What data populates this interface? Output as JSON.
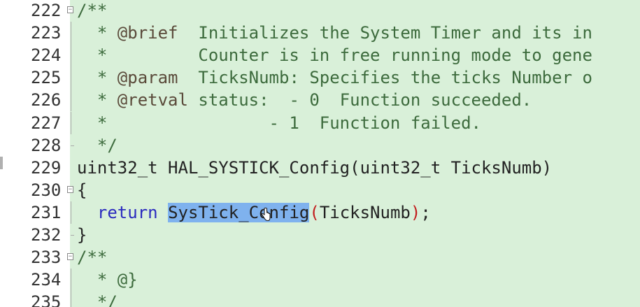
{
  "editor": {
    "lines": [
      {
        "num": "222",
        "parts": [
          {
            "t": "/**",
            "c": "comment"
          }
        ]
      },
      {
        "num": "223",
        "parts": [
          {
            "t": "  * ",
            "c": "comment"
          },
          {
            "t": "@brief",
            "c": "comment-tag"
          },
          {
            "t": "  Initializes the System Timer and its in",
            "c": "comment"
          }
        ]
      },
      {
        "num": "224",
        "parts": [
          {
            "t": "  *         Counter is in free running mode to gene",
            "c": "comment"
          }
        ]
      },
      {
        "num": "225",
        "parts": [
          {
            "t": "  * ",
            "c": "comment"
          },
          {
            "t": "@param",
            "c": "comment-tag"
          },
          {
            "t": "  TicksNumb: Specifies the ticks Number o",
            "c": "comment"
          }
        ]
      },
      {
        "num": "226",
        "parts": [
          {
            "t": "  * ",
            "c": "comment"
          },
          {
            "t": "@retval",
            "c": "comment-tag"
          },
          {
            "t": " status:  - 0  Function succeeded.",
            "c": "comment"
          }
        ]
      },
      {
        "num": "227",
        "parts": [
          {
            "t": "  *                - 1  Function failed.",
            "c": "comment"
          }
        ]
      },
      {
        "num": "228",
        "parts": [
          {
            "t": "  */",
            "c": "comment"
          }
        ]
      },
      {
        "num": "229",
        "parts": [
          {
            "t": "uint32_t HAL_SYSTICK_Config(uint32_t TicksNumb)",
            "c": ""
          }
        ]
      },
      {
        "num": "230",
        "parts": [
          {
            "t": "{",
            "c": ""
          }
        ]
      },
      {
        "num": "231",
        "parts": [
          {
            "t": "  ",
            "c": ""
          },
          {
            "t": "return",
            "c": "kw"
          },
          {
            "t": " ",
            "c": ""
          },
          {
            "t": "SysTick_Config",
            "c": "sel"
          },
          {
            "t": "(",
            "c": "paren-red"
          },
          {
            "t": "TicksNumb",
            "c": ""
          },
          {
            "t": ")",
            "c": "paren-red"
          },
          {
            "t": ";",
            "c": ""
          }
        ]
      },
      {
        "num": "232",
        "parts": [
          {
            "t": "}",
            "c": ""
          }
        ]
      },
      {
        "num": "233",
        "parts": [
          {
            "t": "/**",
            "c": "comment"
          }
        ]
      },
      {
        "num": "234",
        "parts": [
          {
            "t": "  * @}",
            "c": "comment"
          }
        ]
      },
      {
        "num": "235",
        "parts": [
          {
            "t": "  */",
            "c": "comment"
          }
        ]
      }
    ],
    "fold_markers": [
      "box",
      "vline",
      "vline",
      "vline",
      "vline",
      "vline",
      "tick",
      "none",
      "box",
      "vline",
      "tick",
      "box",
      "vline",
      "vline"
    ],
    "selected_text": "SysTick_Config",
    "cursor": "hand-pointer-icon"
  },
  "colors": {
    "code_background": "#d9f0d9",
    "selection": "#7fb2ee",
    "keyword": "#2b2bbf",
    "bracket_highlight": "#c21e1e"
  }
}
